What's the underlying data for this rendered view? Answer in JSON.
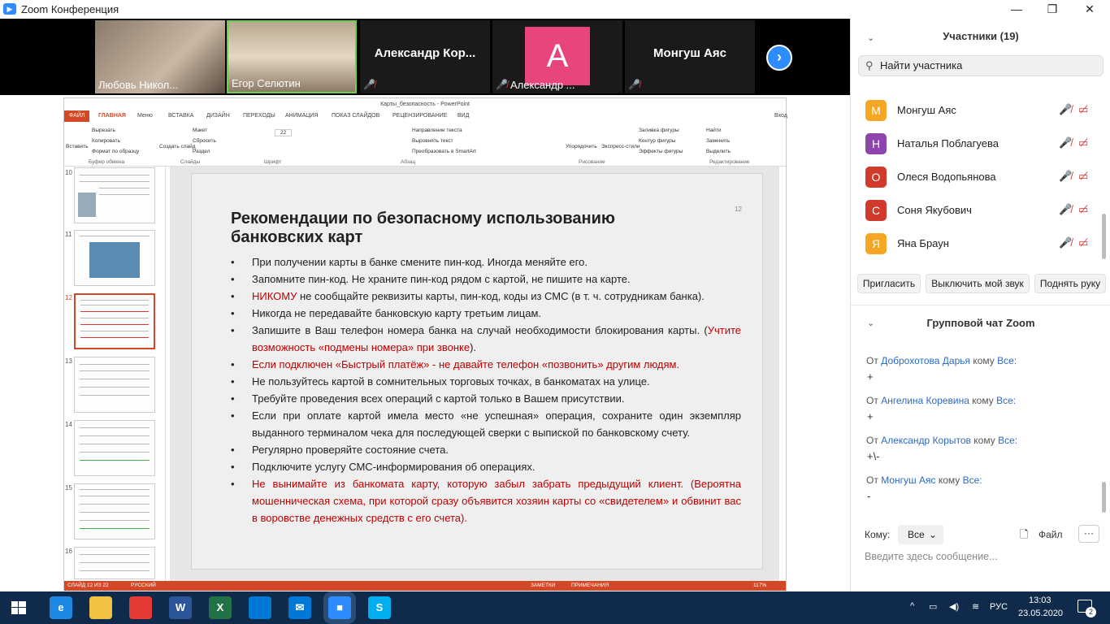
{
  "window": {
    "title": "Zoom Конференция",
    "minimize": "—",
    "maximize": "❐",
    "close": "✕"
  },
  "video": {
    "tiles": [
      {
        "name": "Любовь Никол...",
        "type": "camera"
      },
      {
        "name": "Егор Селютин",
        "type": "camera"
      },
      {
        "name": "Александр  Кор...",
        "type": "name_only"
      },
      {
        "name": "Александр ...",
        "type": "avatar",
        "letter": "A"
      },
      {
        "name": "Монгуш Аяс",
        "type": "name_only"
      }
    ],
    "next": "›"
  },
  "ppt": {
    "title": "Карты_безопасность - PowerPoint",
    "account": "Вход",
    "tabs": [
      "ФАЙЛ",
      "ГЛАВНАЯ",
      "Меню",
      "ВСТАВКА",
      "ДИЗАЙН",
      "ПЕРЕХОДЫ",
      "АНИМАЦИЯ",
      "ПОКАЗ СЛАЙДОВ",
      "РЕЦЕНЗИРОВАНИЕ",
      "ВИД"
    ],
    "ribbon": {
      "paste": "Вставить",
      "cut": "Вырезать",
      "copy": "Копировать",
      "format": "Формат по образцу",
      "create_slide": "Создать слайд",
      "layout": "Макет",
      "reset": "Сбросить",
      "section": "Раздел",
      "font_size": "22",
      "text_direction": "Направление текста",
      "align_text": "Выровнять текст",
      "smartart": "Преобразовать в SmartArt",
      "arrange": "Упорядочить",
      "express_styles": "Экспресс-стили",
      "shape_fill": "Заливка фигуры",
      "shape_outline": "Контур фигуры",
      "shape_effects": "Эффекты фигуры",
      "find": "Найти",
      "replace": "Заменить",
      "select": "Выделить",
      "groups": [
        "Буфер обмена",
        "Слайды",
        "Шрифт",
        "Абзац",
        "Рисование",
        "Редактирование"
      ]
    },
    "thumbnails": [
      "10",
      "11",
      "12",
      "13",
      "14",
      "15",
      "16"
    ],
    "slide": {
      "number": "12",
      "title": "Рекомендации по безопасному использованию банковских карт",
      "bullets": [
        {
          "parts": [
            {
              "t": "При получении карты в банке смените пин-код. Иногда меняйте его.",
              "c": ""
            }
          ]
        },
        {
          "parts": [
            {
              "t": "Запомните пин-код. Не храните пин-код рядом с картой, не пишите на карте.",
              "c": ""
            }
          ]
        },
        {
          "parts": [
            {
              "t": "НИКОМУ",
              "c": "red"
            },
            {
              "t": " не сообщайте реквизиты карты, пин-код, коды из СМС (в т. ч. сотрудникам банка).",
              "c": ""
            }
          ]
        },
        {
          "parts": [
            {
              "t": "Никогда не передавайте банковскую карту третьим лицам.",
              "c": ""
            }
          ]
        },
        {
          "parts": [
            {
              "t": "Запишите в Ваш телефон номера банка на случай необходимости блокирования карты. (",
              "c": ""
            },
            {
              "t": "Учтите возможность «подмены номера» при звонке",
              "c": "red"
            },
            {
              "t": ").",
              "c": ""
            }
          ]
        },
        {
          "parts": [
            {
              "t": "Если подключен «Быстрый платёж» - не давайте телефон «позвонить» другим людям.",
              "c": "red"
            }
          ]
        },
        {
          "parts": [
            {
              "t": "Не пользуйтесь картой в сомнительных торговых точках, в банкоматах на улице.",
              "c": ""
            }
          ]
        },
        {
          "parts": [
            {
              "t": "Требуйте проведения всех операций с картой только в Вашем присутствии.",
              "c": ""
            }
          ]
        },
        {
          "parts": [
            {
              "t": "Если при оплате картой имела место «не успешная» операция, сохраните один экземпляр выданного терминалом чека для последующей сверки с выпиской по банковскому счету.",
              "c": ""
            }
          ]
        },
        {
          "parts": [
            {
              "t": "Регулярно проверяйте состояние счета.",
              "c": ""
            }
          ]
        },
        {
          "parts": [
            {
              "t": "Подключите услугу СМС-информирования об операциях.",
              "c": ""
            }
          ]
        },
        {
          "parts": [
            {
              "t": "Не вынимайте из банкомата карту, которую забыл забрать предыдущий клиент. (Вероятна мошенническая схема, при которой сразу объявится хозяин карты со «свидетелем» и обвинит вас в воровстве денежных средств с его счета).",
              "c": "red"
            }
          ]
        }
      ]
    },
    "status": {
      "slide": "СЛАЙД 12 ИЗ 22",
      "lang": "РУССКИЙ",
      "notes": "ЗАМЕТКИ",
      "comments": "ПРИМЕЧАНИЯ",
      "zoom": "117%"
    }
  },
  "panel": {
    "participants_title": "Участники (19)",
    "search_placeholder": "Найти участника",
    "participants": [
      {
        "letter": "М",
        "name": "Монгуш Аяс",
        "color": "#f5a623"
      },
      {
        "letter": "Н",
        "name": "Наталья Поблагуева",
        "color": "#8e44ad"
      },
      {
        "letter": "О",
        "name": "Олеся Водопьянова",
        "color": "#d0392b"
      },
      {
        "letter": "С",
        "name": "Соня Якубович",
        "color": "#d0392b"
      },
      {
        "letter": "Я",
        "name": "Яна Браун",
        "color": "#f5a623"
      }
    ],
    "buttons": {
      "invite": "Пригласить",
      "mute": "Выключить мой звук",
      "hand": "Поднять руку"
    },
    "chat_title": "Групповой чат Zoom",
    "messages": [
      {
        "from": "От",
        "user": "Доброхотова Дарья",
        "to": "кому",
        "target": "Все:",
        "text": "+"
      },
      {
        "from": "От",
        "user": "Ангелина Коревина",
        "to": "кому",
        "target": "Все:",
        "text": "+"
      },
      {
        "from": "От",
        "user": "Александр Корытов",
        "to": "кому",
        "target": "Все:",
        "text": "+\\-"
      },
      {
        "from": "От",
        "user": "Монгуш Аяс",
        "to": "кому",
        "target": "Все:",
        "text": "-"
      }
    ],
    "to_label": "Кому:",
    "to_value": "Все",
    "file": "Файл",
    "more": "···",
    "input_placeholder": "Введите здесь сообщение..."
  },
  "taskbar": {
    "apps": [
      {
        "icon": "edge-icon",
        "glyph": "e",
        "color": "#1e88e5"
      },
      {
        "icon": "folder-icon",
        "glyph": "",
        "color": "#f4c242"
      },
      {
        "icon": "chrome-icon",
        "glyph": "",
        "color": "#e53935"
      },
      {
        "icon": "word-icon",
        "glyph": "W",
        "color": "#2b579a"
      },
      {
        "icon": "excel-icon",
        "glyph": "X",
        "color": "#217346"
      },
      {
        "icon": "store-icon",
        "glyph": "",
        "color": "#0078d7"
      },
      {
        "icon": "mail-icon",
        "glyph": "✉",
        "color": "#0078d7"
      },
      {
        "icon": "zoom-icon",
        "glyph": "■",
        "color": "#2d8cff"
      },
      {
        "icon": "skype-icon",
        "glyph": "S",
        "color": "#00aff0"
      }
    ],
    "lang": "РУС",
    "time": "13:03",
    "date": "23.05.2020",
    "notifications": "2"
  }
}
